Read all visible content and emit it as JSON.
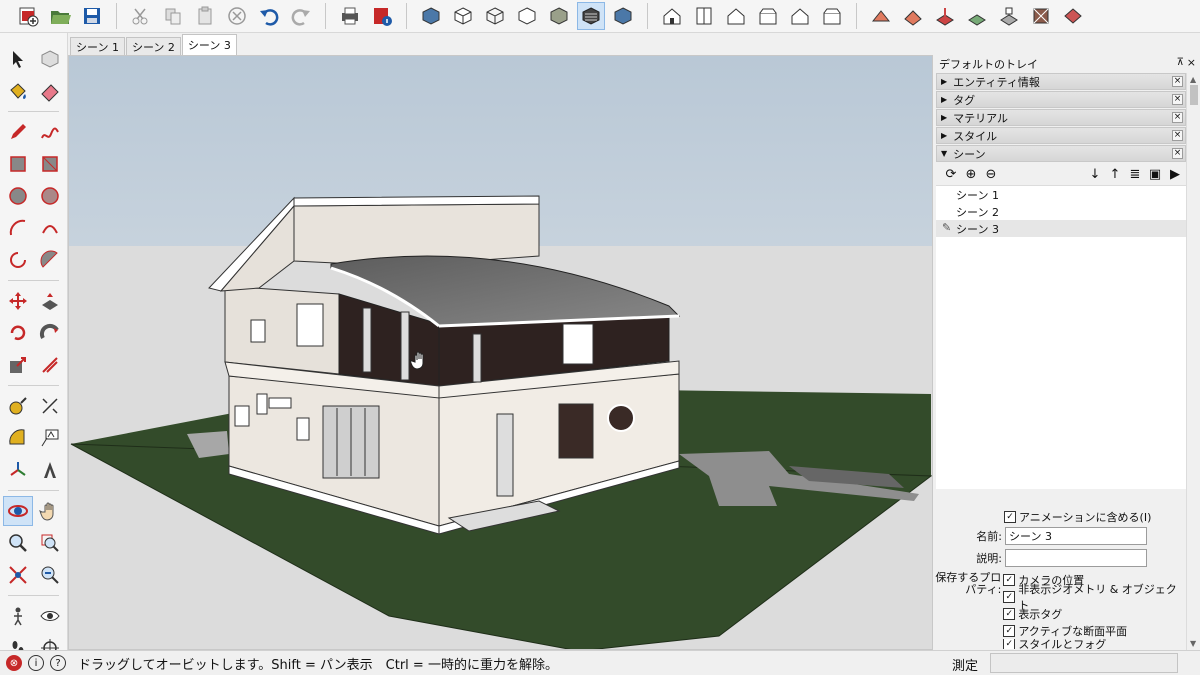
{
  "tabs": [
    "シーン 1",
    "シーン 2",
    "シーン 3"
  ],
  "active_tab": "シーン 3",
  "tray": {
    "title": "デフォルトのトレイ",
    "pin": "⊼",
    "close": "×",
    "panels": [
      {
        "label": "エンティティ情報",
        "expanded": false
      },
      {
        "label": "タグ",
        "expanded": false
      },
      {
        "label": "マテリアル",
        "expanded": false
      },
      {
        "label": "スタイル",
        "expanded": false
      },
      {
        "label": "シーン",
        "expanded": true
      }
    ],
    "scenes": [
      "シーン 1",
      "シーン 2",
      "シーン 3"
    ],
    "selected_scene": "シーン 3",
    "props": {
      "include_animation": "アニメーションに含める(I)",
      "name_label": "名前:",
      "name_value": "シーン 3",
      "desc_label": "説明:",
      "desc_value": "",
      "save_label_1": "保存するプロ",
      "save_label_2": "パティ:",
      "checks": [
        "カメラの位置",
        "非表示ジオメトリ & オブジェクト",
        "表示タグ",
        "アクティブな断面平面",
        "スタイルとフォグ"
      ]
    }
  },
  "status": {
    "text": "ドラッグしてオービットします。Shift = パン表示　Ctrl = 一時的に重力を解除。",
    "measure_label": "測定",
    "measure_value": ""
  },
  "colors": {
    "accent_red": "#c62828",
    "accent_blue": "#1565c0",
    "ground": "#334b2a",
    "sky_top": "#b9c8d6",
    "wall": "#ece7e0",
    "dark_wall": "#2e2220",
    "roof": "#6a6a6a"
  }
}
